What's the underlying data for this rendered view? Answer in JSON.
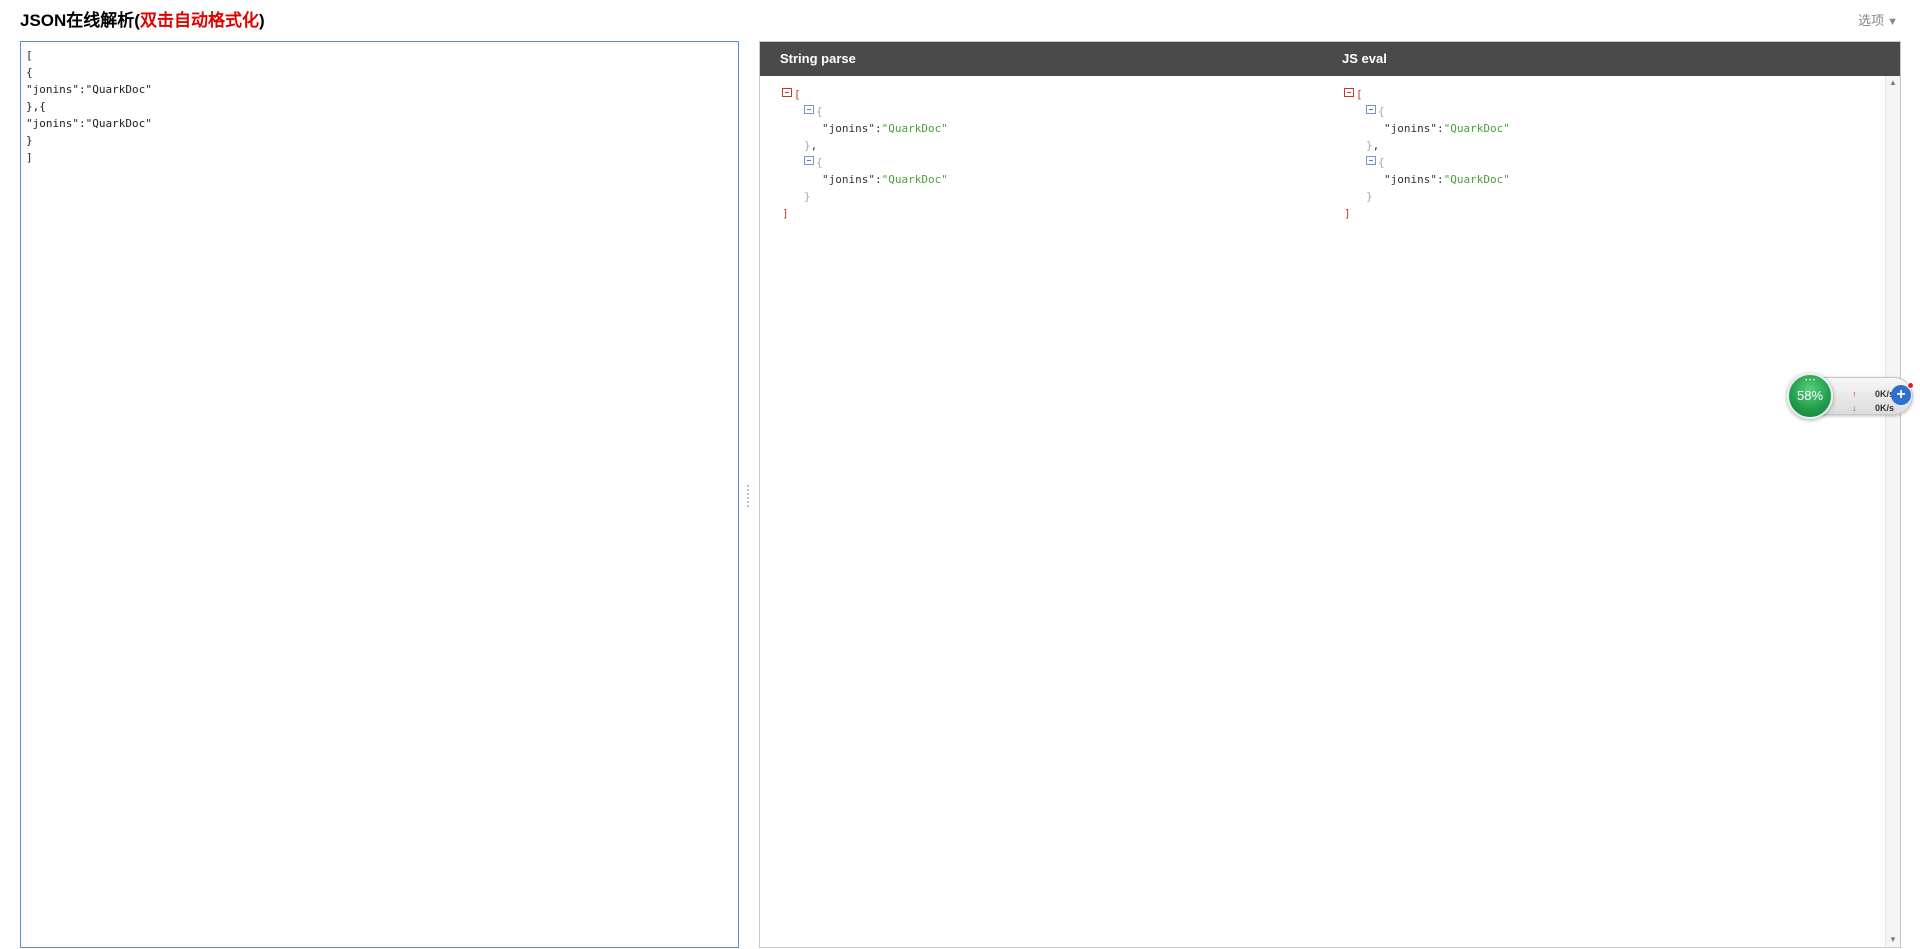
{
  "header": {
    "title_prefix": "JSON在线解析(",
    "title_highlight": "双击自动格式化",
    "title_suffix": ")",
    "options_label": "选项",
    "options_caret": "▼"
  },
  "editor": {
    "value": "[\n{\n\"jonins\":\"QuarkDoc\"\n},{\n\"jonins\":\"QuarkDoc\"\n}\n]"
  },
  "output": {
    "columns": [
      "String parse",
      "JS eval"
    ],
    "tree": {
      "open_bracket": "[",
      "close_bracket": "]",
      "open_brace": "{",
      "close_brace": "}",
      "comma": ",",
      "key": "\"jonins\"",
      "colon": ":",
      "value": "\"QuarkDoc\""
    }
  },
  "net_widget": {
    "percent": "58%",
    "upload_speed": "0K/s",
    "download_speed": "0K/s",
    "up_arrow": "↑",
    "down_arrow": "↓",
    "plus": "+"
  },
  "colors": {
    "editor_border": "#5b8de8",
    "header_bg": "#4a4a4a",
    "highlight_red": "#e00000",
    "string_green": "#4aa23a",
    "bracket_red": "#c0392b"
  }
}
